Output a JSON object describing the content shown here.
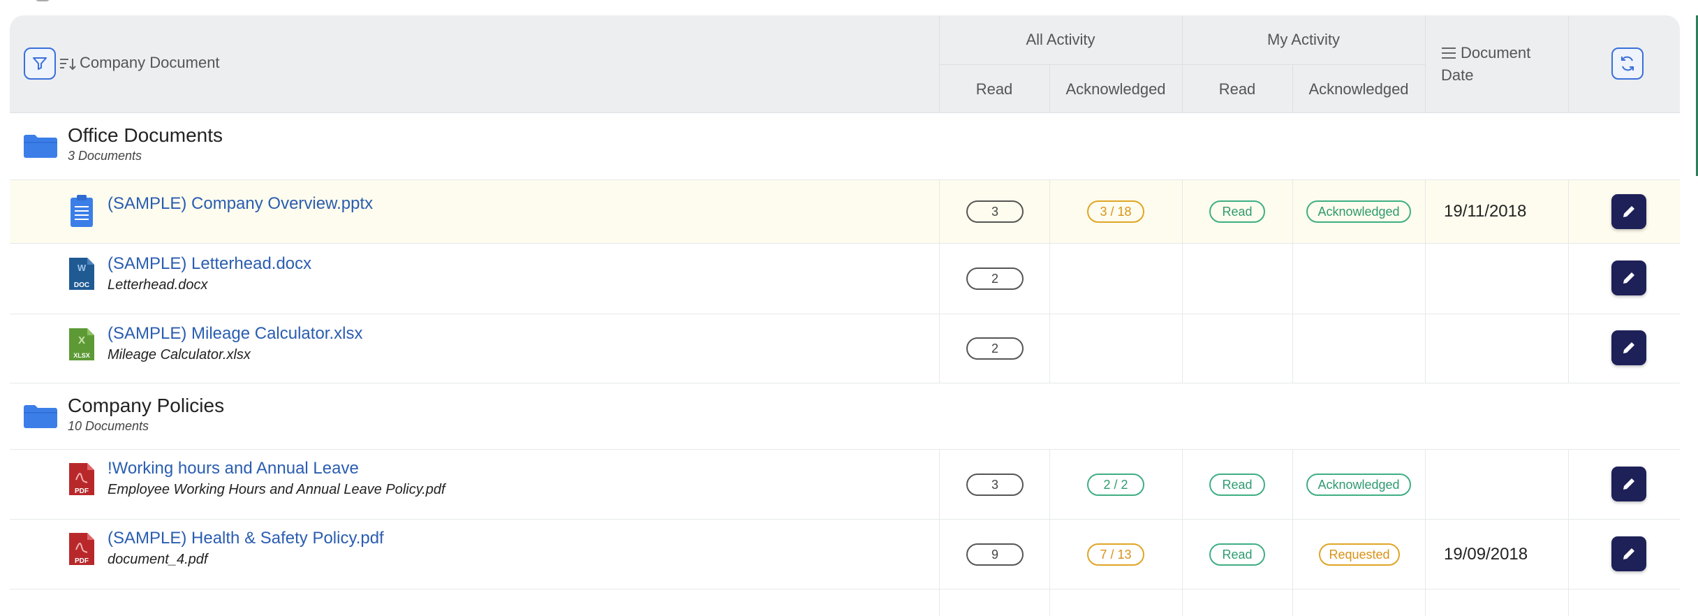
{
  "header": {
    "company_document": "Company Document",
    "all_activity": "All Activity",
    "my_activity": "My Activity",
    "read": "Read",
    "acknowledged": "Acknowledged",
    "document_date": "Document Date"
  },
  "icons": {
    "filter": "filter-icon",
    "sort": "sort-icon",
    "refresh": "refresh-icon",
    "columns": "columns-icon",
    "edit": "pencil-icon"
  },
  "folders": [
    {
      "name": "Office Documents",
      "count": "3 Documents"
    },
    {
      "name": "Company Policies",
      "count": "10 Documents"
    }
  ],
  "documents": [
    {
      "title": "(SAMPLE) Company Overview.pptx",
      "file": "",
      "type": "clipboard",
      "read_count": "3",
      "ack_ratio": "3 / 18",
      "ack_color": "amber",
      "my_read": "Read",
      "my_ack": "Acknowledged",
      "my_ack_color": "green",
      "date": "19/11/2018"
    },
    {
      "title": "(SAMPLE) Letterhead.docx",
      "file": "Letterhead.docx",
      "type": "doc",
      "read_count": "2",
      "ack_ratio": "",
      "my_read": "",
      "my_ack": "",
      "date": ""
    },
    {
      "title": "(SAMPLE) Mileage Calculator.xlsx",
      "file": "Mileage Calculator.xlsx",
      "type": "xlsx",
      "read_count": "2",
      "ack_ratio": "",
      "my_read": "",
      "my_ack": "",
      "date": ""
    },
    {
      "title": "!Working hours and Annual Leave",
      "file": "Employee Working Hours and Annual Leave Policy.pdf",
      "type": "pdf",
      "read_count": "3",
      "ack_ratio": "2 / 2",
      "ack_color": "green",
      "my_read": "Read",
      "my_ack": "Acknowledged",
      "my_ack_color": "green",
      "date": ""
    },
    {
      "title": "(SAMPLE) Health & Safety Policy.pdf",
      "file": "document_4.pdf",
      "type": "pdf",
      "read_count": "9",
      "ack_ratio": "7 / 13",
      "ack_color": "amber",
      "my_read": "Read",
      "my_ack": "Requested",
      "my_ack_color": "amber",
      "date": "19/09/2018"
    }
  ],
  "file_badges": {
    "doc": "DOC",
    "xlsx": "XLSX",
    "pdf": "PDF"
  },
  "colors": {
    "link": "#2a5db0",
    "edit_button": "#1e2058",
    "highlight_row": "#fefcee",
    "green": "#3fae83",
    "amber": "#e0a526"
  }
}
